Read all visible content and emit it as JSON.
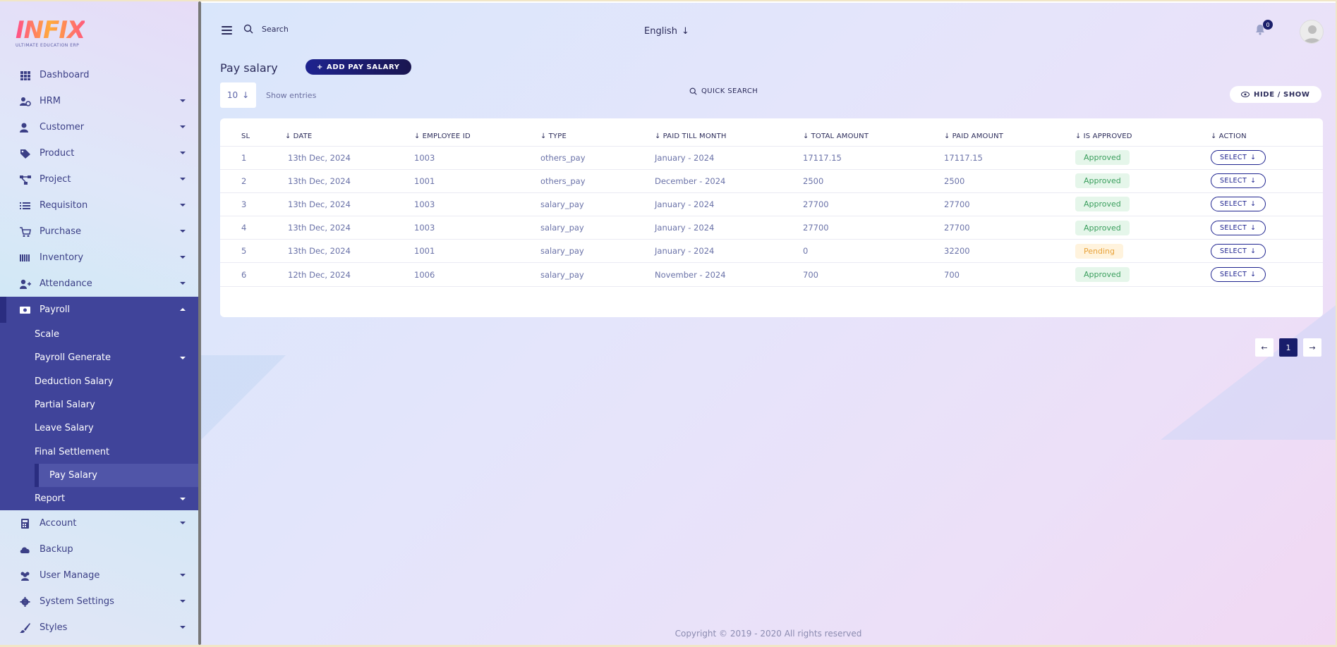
{
  "brand": {
    "logo_text": "INFIX",
    "tagline": "ULTIMATE EDUCATION ERP"
  },
  "sidebar": {
    "items_top": [
      {
        "label": "Dashboard",
        "icon": "grid-icon",
        "caret": false
      },
      {
        "label": "HRM",
        "icon": "users-cog-icon",
        "caret": true
      },
      {
        "label": "Customer",
        "icon": "user-icon",
        "caret": true
      },
      {
        "label": "Product",
        "icon": "tag-icon",
        "caret": true
      },
      {
        "label": "Project",
        "icon": "project-diagram-icon",
        "caret": true
      },
      {
        "label": "Requisiton",
        "icon": "list-icon",
        "caret": true
      },
      {
        "label": "Purchase",
        "icon": "cart-icon",
        "caret": true
      },
      {
        "label": "Inventory",
        "icon": "bars-icon",
        "caret": true
      },
      {
        "label": "Attendance",
        "icon": "user-plus-icon",
        "caret": true
      }
    ],
    "open_item": {
      "label": "Payroll",
      "icon": "money-icon"
    },
    "submenu": [
      {
        "label": "Scale",
        "caret": false
      },
      {
        "label": "Payroll Generate",
        "caret": true
      },
      {
        "label": "Deduction Salary",
        "caret": false
      },
      {
        "label": "Partial Salary",
        "caret": false
      },
      {
        "label": "Leave Salary",
        "caret": false
      },
      {
        "label": "Final Settlement",
        "caret": false
      },
      {
        "label": "Pay Salary",
        "caret": false,
        "active": true
      },
      {
        "label": "Report",
        "caret": true
      }
    ],
    "items_bottom": [
      {
        "label": "Account",
        "icon": "calculator-icon",
        "caret": true
      },
      {
        "label": "Backup",
        "icon": "cloud-icon",
        "caret": false
      },
      {
        "label": "User Manage",
        "icon": "users-icon",
        "caret": true
      },
      {
        "label": "System Settings",
        "icon": "gear-icon",
        "caret": true
      },
      {
        "label": "Styles",
        "icon": "brush-icon",
        "caret": true
      }
    ]
  },
  "topbar": {
    "search_placeholder": "Search",
    "language": "English",
    "notification_count": "0"
  },
  "page": {
    "title": "Pay salary",
    "add_button": "ADD PAY SALARY",
    "entries_value": "10",
    "entries_label": "Show entries",
    "quick_search": "QUICK SEARCH",
    "hide_show": "HIDE / SHOW"
  },
  "table": {
    "columns": [
      "SL",
      "DATE",
      "EMPLOYEE ID",
      "TYPE",
      "PAID TILL MONTH",
      "TOTAL AMOUNT",
      "PAID AMOUNT",
      "IS APPROVED",
      "ACTION"
    ],
    "rows": [
      {
        "sl": "1",
        "date": "13th Dec, 2024",
        "employee_id": "1003",
        "type": "others_pay",
        "paid_till": "January - 2024",
        "total": "17117.15",
        "paid": "17117.15",
        "status": "Approved",
        "action": "SELECT"
      },
      {
        "sl": "2",
        "date": "13th Dec, 2024",
        "employee_id": "1001",
        "type": "others_pay",
        "paid_till": "December - 2024",
        "total": "2500",
        "paid": "2500",
        "status": "Approved",
        "action": "SELECT"
      },
      {
        "sl": "3",
        "date": "13th Dec, 2024",
        "employee_id": "1003",
        "type": "salary_pay",
        "paid_till": "January - 2024",
        "total": "27700",
        "paid": "27700",
        "status": "Approved",
        "action": "SELECT"
      },
      {
        "sl": "4",
        "date": "13th Dec, 2024",
        "employee_id": "1003",
        "type": "salary_pay",
        "paid_till": "January - 2024",
        "total": "27700",
        "paid": "27700",
        "status": "Approved",
        "action": "SELECT"
      },
      {
        "sl": "5",
        "date": "13th Dec, 2024",
        "employee_id": "1001",
        "type": "salary_pay",
        "paid_till": "January - 2024",
        "total": "0",
        "paid": "32200",
        "status": "Pending",
        "action": "SELECT"
      },
      {
        "sl": "6",
        "date": "12th Dec, 2024",
        "employee_id": "1006",
        "type": "salary_pay",
        "paid_till": "November - 2024",
        "total": "700",
        "paid": "700",
        "status": "Approved",
        "action": "SELECT"
      }
    ]
  },
  "pagination": {
    "current": "1"
  },
  "footer": {
    "copyright": "Copyright © 2019 - 2020 All rights reserved"
  },
  "colors": {
    "accent": "#1e238f",
    "sidebar_open": "#40449a",
    "approved": "#3a9e5d",
    "pending": "#e8a23a"
  }
}
